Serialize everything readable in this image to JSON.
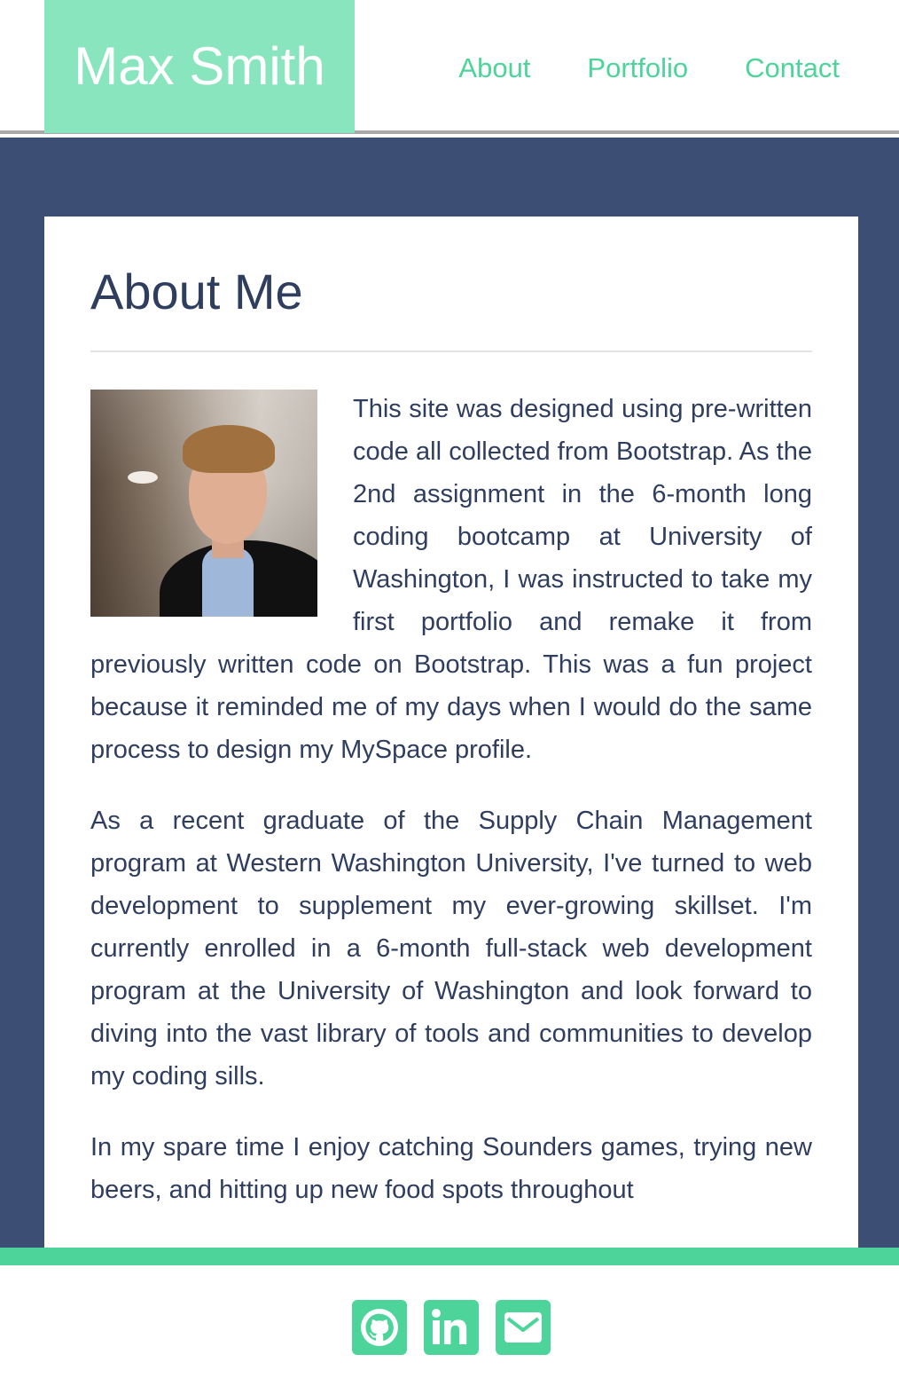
{
  "header": {
    "brand": "Max Smith",
    "nav": [
      "About",
      "Portfolio",
      "Contact"
    ]
  },
  "main": {
    "title": "About Me",
    "photo_alt": "Profile photo of Max Smith",
    "paragraphs": [
      "This site was designed using pre-written code all collected from Bootstrap. As the 2nd assignment in the 6-month long coding bootcamp at University of Washington, I was instructed to take my first portfolio and remake it from previously written code on Bootstrap. This was a fun project because it reminded me of my days when I would do the same process to design my MySpace profile.",
      "As a recent graduate of the Supply Chain Management program at Western Washington University, I've turned to web development to supplement my ever-growing skillset. I'm currently enrolled in a 6-month full-stack web development program at the University of Washington and look forward to diving into the vast library of tools and communities to develop my coding sills.",
      "In my spare time I enjoy catching Sounders games, trying new beers, and hitting up new food spots throughout"
    ]
  },
  "footer": {
    "icons": [
      "github-icon",
      "linkedin-icon",
      "envelope-icon"
    ]
  },
  "colors": {
    "accent": "#4cd49a",
    "brand_bg": "#88e5bd",
    "band": "#3d4e74",
    "text": "#2f3d5f"
  }
}
